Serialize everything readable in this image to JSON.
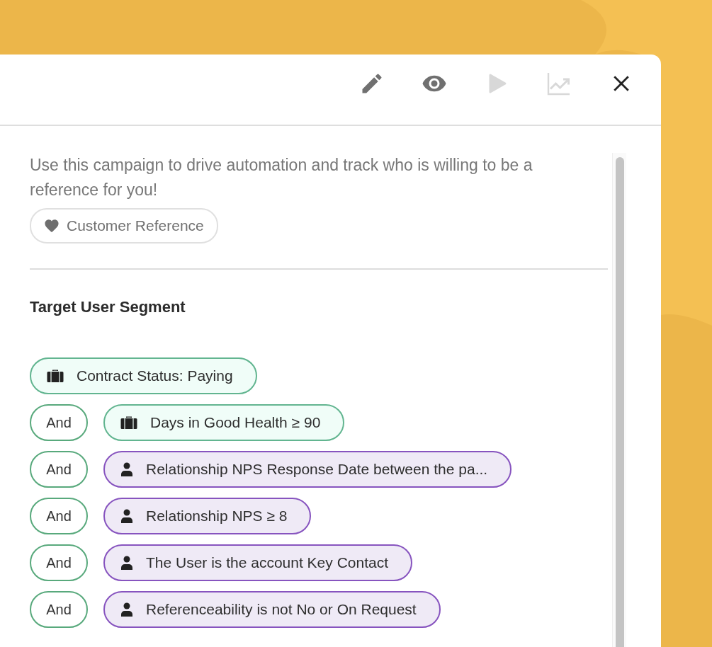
{
  "toolbar": [
    {
      "kind": "edit",
      "disabled": false
    },
    {
      "kind": "preview",
      "disabled": false
    },
    {
      "kind": "run",
      "disabled": true
    },
    {
      "kind": "analytics",
      "disabled": true
    },
    {
      "kind": "close",
      "disabled": false
    }
  ],
  "description": "Use this campaign to drive automation and track who is willing to be a reference for you!",
  "tag": {
    "label": "Customer Reference"
  },
  "segment": {
    "title": "Target User Segment",
    "conditions": [
      {
        "kind": "account",
        "label": "Contract Status: Paying"
      },
      {
        "connector": "And",
        "kind": "account",
        "label": "Days in Good Health ≥ 90"
      },
      {
        "connector": "And",
        "kind": "user",
        "label": "Relationship NPS Response Date between the pa..."
      },
      {
        "connector": "And",
        "kind": "user",
        "label": "Relationship NPS ≥ 8"
      },
      {
        "connector": "And",
        "kind": "user",
        "label": "The User is the account Key Contact"
      },
      {
        "connector": "And",
        "kind": "user",
        "label": "Referenceability is not No or On Request"
      }
    ]
  }
}
